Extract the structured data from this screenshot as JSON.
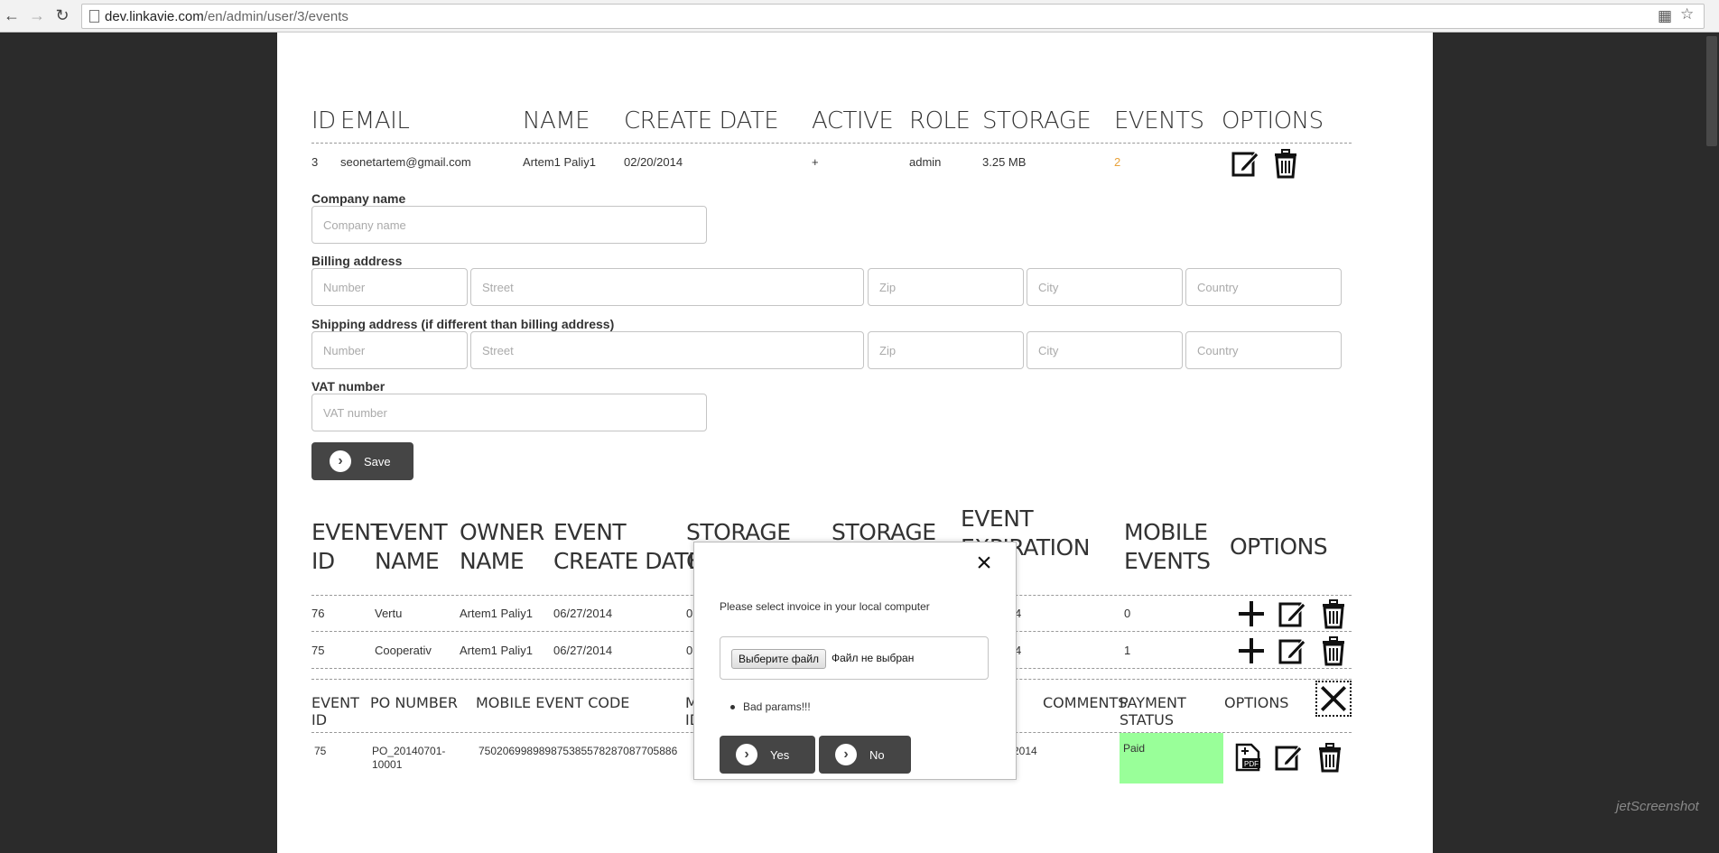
{
  "browser": {
    "url_host": "dev.linkavie.com",
    "url_path": "/en/admin/user/3/events"
  },
  "user_table": {
    "headers": [
      "ID",
      "EMAIL",
      "NAME",
      "CREATE DATE",
      "ACTIVE",
      "ROLE",
      "STORAGE",
      "EVENTS",
      "OPTIONS"
    ],
    "row": {
      "id": "3",
      "email": "seonetartem@gmail.com",
      "name": "Artem1 Paliy1",
      "create_date": "02/20/2014",
      "active": "+",
      "role": "admin",
      "storage": "3.25 MB",
      "events": "2"
    }
  },
  "form": {
    "company_label": "Company name",
    "company_placeholder": "Company name",
    "billing_label": "Billing address",
    "shipping_label": "Shipping address (if different than billing address)",
    "number_placeholder": "Number",
    "street_placeholder": "Street",
    "zip_placeholder": "Zip",
    "city_placeholder": "City",
    "country_placeholder": "Country",
    "vat_label": "VAT number",
    "vat_placeholder": "VAT number",
    "save_label": "Save"
  },
  "events_table": {
    "headers": {
      "event_id_1": "EVENT",
      "event_id_2": "ID",
      "event_name_1": "EVENT",
      "event_name_2": "NAME",
      "owner_1": "OWNER",
      "owner_2": "NAME",
      "create_1": "EVENT",
      "create_2": "CREATE DATE",
      "storage_a": "STORAGE",
      "storage_a_2": "C",
      "storage_b": "STORAGE",
      "expiration_1": "EVENT",
      "expiration_2": "EXPIRATION",
      "mobile_1": "MOBILE",
      "mobile_2": "EVENTS",
      "options": "OPTIONS"
    },
    "rows": [
      {
        "id": "76",
        "name": "Vertu",
        "owner": "Artem1 Paliy1",
        "date": "06/27/2014",
        "storage": "0.",
        "expiration": "4",
        "mobile": "0"
      },
      {
        "id": "75",
        "name": "Cooperativ",
        "owner": "Artem1 Paliy1",
        "date": "06/27/2014",
        "storage": "0.",
        "expiration": "4",
        "mobile": "1"
      }
    ]
  },
  "invoice_table": {
    "headers": {
      "event_id_1": "EVENT",
      "event_id_2": "ID",
      "po": "PO NUMBER",
      "code": "MOBILE EVENT CODE",
      "col_m_1": "M",
      "col_m_2": "ID",
      "comments": "COMMENTS",
      "payment_1": "PAYMENT",
      "payment_2": "STATUS",
      "options": "OPTIONS"
    },
    "row": {
      "event_id": "75",
      "po_1": "PO_20140701-",
      "po_2": "10001",
      "code": "750206998989875385578287087705886",
      "year": "2014",
      "status": "Paid"
    }
  },
  "modal": {
    "message": "Please select invoice in your local computer",
    "file_button": "Выберите файл",
    "file_text": "Файл не выбран",
    "error": "Bad params!!!",
    "yes_label": "Yes",
    "no_label": "No"
  },
  "watermark": "jetScreenshot"
}
